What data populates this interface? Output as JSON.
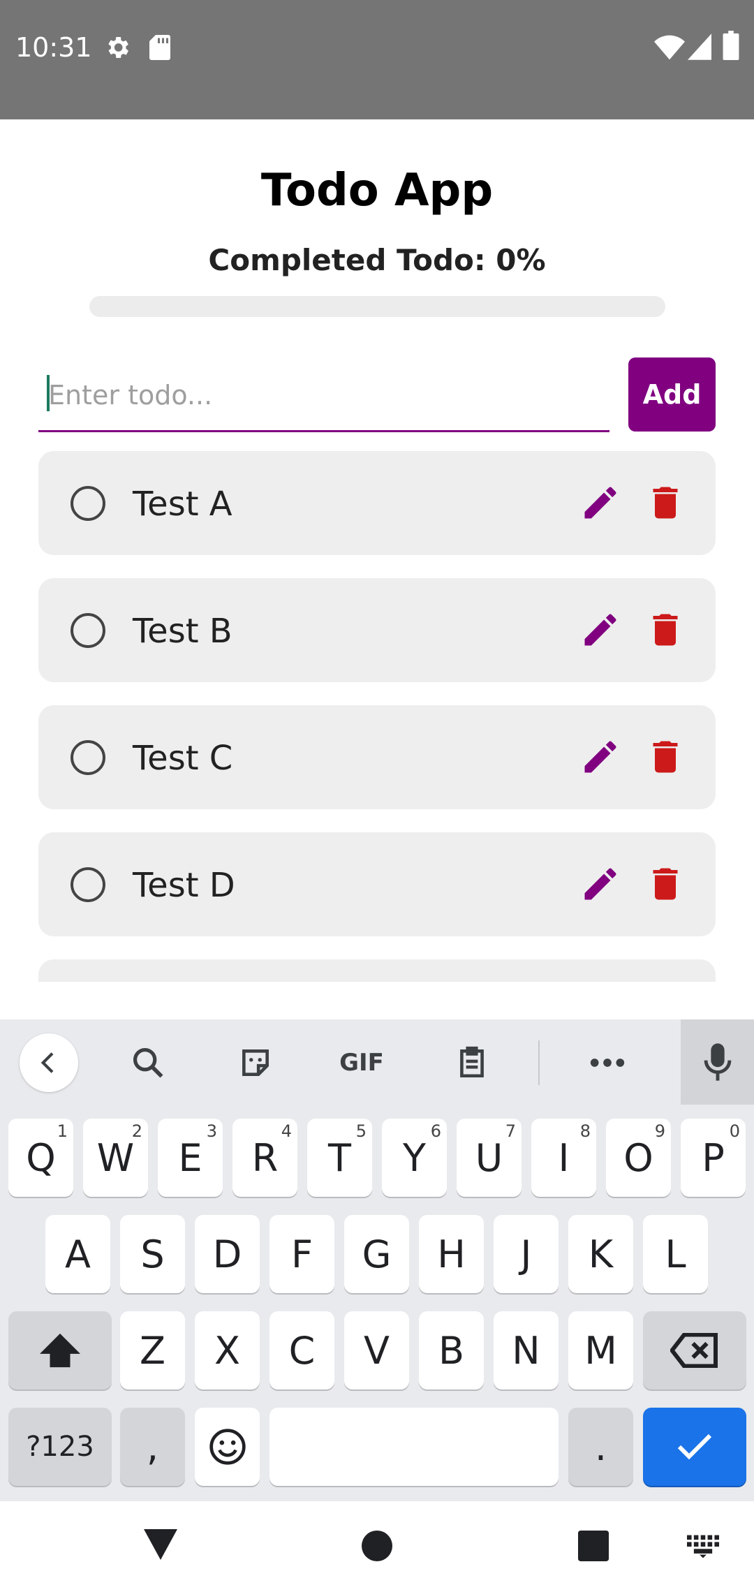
{
  "status_bar": {
    "time": "10:31",
    "left_icons": [
      "gear-icon",
      "sd-card-icon"
    ],
    "right_icons": [
      "wifi-icon",
      "signal-icon",
      "battery-icon"
    ]
  },
  "app": {
    "title": "Todo App",
    "completed_label": "Completed Todo: 0%",
    "progress_fraction": 0,
    "input_placeholder": "Enter todo...",
    "input_value": "",
    "add_label": "Add",
    "accent_color": "#800080",
    "delete_color": "#cc1a1a",
    "todos": [
      {
        "text": "Test A",
        "done": false
      },
      {
        "text": "Test B",
        "done": false
      },
      {
        "text": "Test C",
        "done": false
      },
      {
        "text": "Test D",
        "done": false
      },
      {
        "text": "",
        "done": false
      }
    ]
  },
  "keyboard": {
    "toolbar": [
      "back-icon",
      "search-icon",
      "sticker-icon",
      "GIF",
      "clipboard-icon",
      "more-icon",
      "mic-icon"
    ],
    "row1": [
      {
        "k": "Q",
        "h": "1"
      },
      {
        "k": "W",
        "h": "2"
      },
      {
        "k": "E",
        "h": "3"
      },
      {
        "k": "R",
        "h": "4"
      },
      {
        "k": "T",
        "h": "5"
      },
      {
        "k": "Y",
        "h": "6"
      },
      {
        "k": "U",
        "h": "7"
      },
      {
        "k": "I",
        "h": "8"
      },
      {
        "k": "O",
        "h": "9"
      },
      {
        "k": "P",
        "h": "0"
      }
    ],
    "row2": [
      "A",
      "S",
      "D",
      "F",
      "G",
      "H",
      "J",
      "K",
      "L"
    ],
    "row3": [
      "Z",
      "X",
      "C",
      "V",
      "B",
      "N",
      "M"
    ],
    "row4": {
      "symbols": "?123",
      "comma": ",",
      "period": "."
    },
    "done_color": "#1a73e8"
  },
  "nav_bar": {
    "icons": [
      "back-triangle-icon",
      "home-circle-icon",
      "recents-square-icon",
      "keyboard-switch-icon"
    ]
  }
}
